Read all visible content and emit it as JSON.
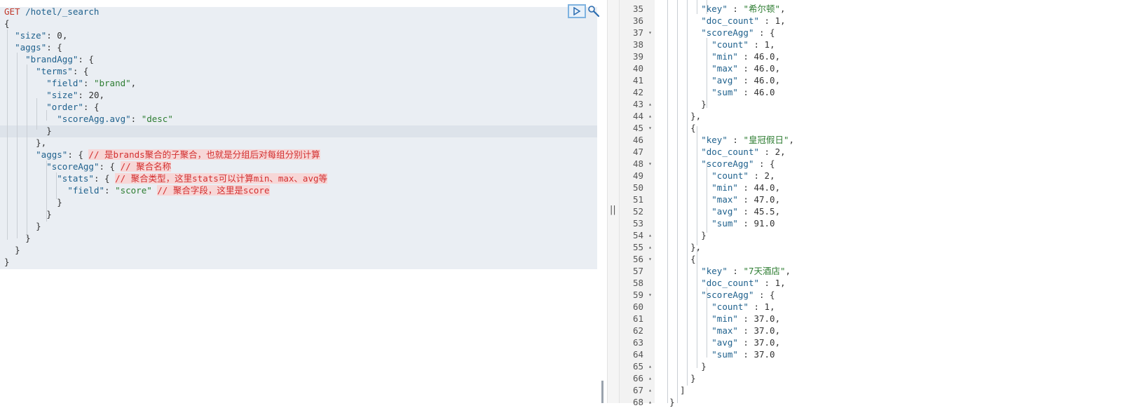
{
  "request": {
    "method": "GET",
    "path": " /hotel/_search",
    "lines": [
      {
        "indent": "",
        "parts": [
          [
            "p",
            "{"
          ]
        ]
      },
      {
        "indent": "  ",
        "parts": [
          [
            "k",
            "\"size\""
          ],
          [
            "p",
            ": "
          ],
          [
            "n",
            "0"
          ],
          [
            "p",
            ","
          ]
        ]
      },
      {
        "indent": "  ",
        "parts": [
          [
            "k",
            "\"aggs\""
          ],
          [
            "p",
            ": {"
          ]
        ]
      },
      {
        "indent": "    ",
        "parts": [
          [
            "k",
            "\"brandAgg\""
          ],
          [
            "p",
            ": {"
          ]
        ]
      },
      {
        "indent": "      ",
        "parts": [
          [
            "k",
            "\"terms\""
          ],
          [
            "p",
            ": {"
          ]
        ]
      },
      {
        "indent": "        ",
        "parts": [
          [
            "k",
            "\"field\""
          ],
          [
            "p",
            ": "
          ],
          [
            "s",
            "\"brand\""
          ],
          [
            "p",
            ","
          ]
        ]
      },
      {
        "indent": "        ",
        "parts": [
          [
            "k",
            "\"size\""
          ],
          [
            "p",
            ": "
          ],
          [
            "n",
            "20"
          ],
          [
            "p",
            ","
          ]
        ]
      },
      {
        "indent": "        ",
        "parts": [
          [
            "k",
            "\"order\""
          ],
          [
            "p",
            ": {"
          ]
        ]
      },
      {
        "indent": "          ",
        "parts": [
          [
            "k",
            "\"scoreAgg.avg\""
          ],
          [
            "p",
            ": "
          ],
          [
            "s",
            "\"desc\""
          ]
        ]
      },
      {
        "indent": "        ",
        "parts": [
          [
            "p",
            "}"
          ]
        ]
      },
      {
        "indent": "      ",
        "parts": [
          [
            "p",
            "},"
          ]
        ]
      },
      {
        "indent": "      ",
        "parts": [
          [
            "k",
            "\"aggs\""
          ],
          [
            "p",
            ": { "
          ],
          [
            "c",
            "// 是brands聚合的子聚合，也就是分组后对每组分别计算"
          ]
        ]
      },
      {
        "indent": "        ",
        "parts": [
          [
            "k",
            "\"scoreAgg\""
          ],
          [
            "p",
            ": { "
          ],
          [
            "c",
            "// 聚合名称"
          ]
        ]
      },
      {
        "indent": "          ",
        "parts": [
          [
            "k",
            "\"stats\""
          ],
          [
            "p",
            ": { "
          ],
          [
            "c",
            "// 聚合类型，这里stats可以计算min、max、avg等"
          ]
        ]
      },
      {
        "indent": "            ",
        "parts": [
          [
            "k",
            "\"field\""
          ],
          [
            "p",
            ": "
          ],
          [
            "s",
            "\"score\""
          ],
          [
            "p",
            " "
          ],
          [
            "c",
            "// 聚合字段，这里是score"
          ]
        ]
      },
      {
        "indent": "          ",
        "parts": [
          [
            "p",
            "}"
          ]
        ]
      },
      {
        "indent": "        ",
        "parts": [
          [
            "p",
            "}"
          ]
        ]
      },
      {
        "indent": "      ",
        "parts": [
          [
            "p",
            "}"
          ]
        ]
      },
      {
        "indent": "    ",
        "parts": [
          [
            "p",
            "}"
          ]
        ]
      },
      {
        "indent": "  ",
        "parts": [
          [
            "p",
            "}"
          ]
        ]
      },
      {
        "indent": "",
        "parts": [
          [
            "p",
            "}"
          ]
        ]
      }
    ]
  },
  "actions": {
    "run_icon": "play-icon",
    "settings_icon": "wrench-icon"
  },
  "divider": {
    "grip": "||"
  },
  "response": {
    "lines": [
      {
        "num": "35",
        "fold": "",
        "indent": "        ",
        "parts": [
          [
            "k",
            "\"key\""
          ],
          [
            "p",
            " : "
          ],
          [
            "s",
            "\"希尔顿\""
          ],
          [
            "p",
            ","
          ]
        ]
      },
      {
        "num": "36",
        "fold": "",
        "indent": "        ",
        "parts": [
          [
            "k",
            "\"doc_count\""
          ],
          [
            "p",
            " : "
          ],
          [
            "n",
            "1"
          ],
          [
            "p",
            ","
          ]
        ]
      },
      {
        "num": "37",
        "fold": "▾",
        "indent": "        ",
        "parts": [
          [
            "k",
            "\"scoreAgg\""
          ],
          [
            "p",
            " : {"
          ]
        ]
      },
      {
        "num": "38",
        "fold": "",
        "indent": "          ",
        "parts": [
          [
            "k",
            "\"count\""
          ],
          [
            "p",
            " : "
          ],
          [
            "n",
            "1"
          ],
          [
            "p",
            ","
          ]
        ]
      },
      {
        "num": "39",
        "fold": "",
        "indent": "          ",
        "parts": [
          [
            "k",
            "\"min\""
          ],
          [
            "p",
            " : "
          ],
          [
            "n",
            "46.0"
          ],
          [
            "p",
            ","
          ]
        ]
      },
      {
        "num": "40",
        "fold": "",
        "indent": "          ",
        "parts": [
          [
            "k",
            "\"max\""
          ],
          [
            "p",
            " : "
          ],
          [
            "n",
            "46.0"
          ],
          [
            "p",
            ","
          ]
        ]
      },
      {
        "num": "41",
        "fold": "",
        "indent": "          ",
        "parts": [
          [
            "k",
            "\"avg\""
          ],
          [
            "p",
            " : "
          ],
          [
            "n",
            "46.0"
          ],
          [
            "p",
            ","
          ]
        ]
      },
      {
        "num": "42",
        "fold": "",
        "indent": "          ",
        "parts": [
          [
            "k",
            "\"sum\""
          ],
          [
            "p",
            " : "
          ],
          [
            "n",
            "46.0"
          ]
        ]
      },
      {
        "num": "43",
        "fold": "▴",
        "indent": "        ",
        "parts": [
          [
            "p",
            "}"
          ]
        ]
      },
      {
        "num": "44",
        "fold": "▴",
        "indent": "      ",
        "parts": [
          [
            "p",
            "},"
          ]
        ]
      },
      {
        "num": "45",
        "fold": "▾",
        "indent": "      ",
        "parts": [
          [
            "p",
            "{"
          ]
        ]
      },
      {
        "num": "46",
        "fold": "",
        "indent": "        ",
        "parts": [
          [
            "k",
            "\"key\""
          ],
          [
            "p",
            " : "
          ],
          [
            "s",
            "\"皇冠假日\""
          ],
          [
            "p",
            ","
          ]
        ]
      },
      {
        "num": "47",
        "fold": "",
        "indent": "        ",
        "parts": [
          [
            "k",
            "\"doc_count\""
          ],
          [
            "p",
            " : "
          ],
          [
            "n",
            "2"
          ],
          [
            "p",
            ","
          ]
        ]
      },
      {
        "num": "48",
        "fold": "▾",
        "indent": "        ",
        "parts": [
          [
            "k",
            "\"scoreAgg\""
          ],
          [
            "p",
            " : {"
          ]
        ]
      },
      {
        "num": "49",
        "fold": "",
        "indent": "          ",
        "parts": [
          [
            "k",
            "\"count\""
          ],
          [
            "p",
            " : "
          ],
          [
            "n",
            "2"
          ],
          [
            "p",
            ","
          ]
        ]
      },
      {
        "num": "50",
        "fold": "",
        "indent": "          ",
        "parts": [
          [
            "k",
            "\"min\""
          ],
          [
            "p",
            " : "
          ],
          [
            "n",
            "44.0"
          ],
          [
            "p",
            ","
          ]
        ]
      },
      {
        "num": "51",
        "fold": "",
        "indent": "          ",
        "parts": [
          [
            "k",
            "\"max\""
          ],
          [
            "p",
            " : "
          ],
          [
            "n",
            "47.0"
          ],
          [
            "p",
            ","
          ]
        ]
      },
      {
        "num": "52",
        "fold": "",
        "indent": "          ",
        "parts": [
          [
            "k",
            "\"avg\""
          ],
          [
            "p",
            " : "
          ],
          [
            "n",
            "45.5"
          ],
          [
            "p",
            ","
          ]
        ]
      },
      {
        "num": "53",
        "fold": "",
        "indent": "          ",
        "parts": [
          [
            "k",
            "\"sum\""
          ],
          [
            "p",
            " : "
          ],
          [
            "n",
            "91.0"
          ]
        ]
      },
      {
        "num": "54",
        "fold": "▴",
        "indent": "        ",
        "parts": [
          [
            "p",
            "}"
          ]
        ]
      },
      {
        "num": "55",
        "fold": "▴",
        "indent": "      ",
        "parts": [
          [
            "p",
            "},"
          ]
        ]
      },
      {
        "num": "56",
        "fold": "▾",
        "indent": "      ",
        "parts": [
          [
            "p",
            "{"
          ]
        ]
      },
      {
        "num": "57",
        "fold": "",
        "indent": "        ",
        "parts": [
          [
            "k",
            "\"key\""
          ],
          [
            "p",
            " : "
          ],
          [
            "s",
            "\"7天酒店\""
          ],
          [
            "p",
            ","
          ]
        ]
      },
      {
        "num": "58",
        "fold": "",
        "indent": "        ",
        "parts": [
          [
            "k",
            "\"doc_count\""
          ],
          [
            "p",
            " : "
          ],
          [
            "n",
            "1"
          ],
          [
            "p",
            ","
          ]
        ]
      },
      {
        "num": "59",
        "fold": "▾",
        "indent": "        ",
        "parts": [
          [
            "k",
            "\"scoreAgg\""
          ],
          [
            "p",
            " : {"
          ]
        ]
      },
      {
        "num": "60",
        "fold": "",
        "indent": "          ",
        "parts": [
          [
            "k",
            "\"count\""
          ],
          [
            "p",
            " : "
          ],
          [
            "n",
            "1"
          ],
          [
            "p",
            ","
          ]
        ]
      },
      {
        "num": "61",
        "fold": "",
        "indent": "          ",
        "parts": [
          [
            "k",
            "\"min\""
          ],
          [
            "p",
            " : "
          ],
          [
            "n",
            "37.0"
          ],
          [
            "p",
            ","
          ]
        ]
      },
      {
        "num": "62",
        "fold": "",
        "indent": "          ",
        "parts": [
          [
            "k",
            "\"max\""
          ],
          [
            "p",
            " : "
          ],
          [
            "n",
            "37.0"
          ],
          [
            "p",
            ","
          ]
        ]
      },
      {
        "num": "63",
        "fold": "",
        "indent": "          ",
        "parts": [
          [
            "k",
            "\"avg\""
          ],
          [
            "p",
            " : "
          ],
          [
            "n",
            "37.0"
          ],
          [
            "p",
            ","
          ]
        ]
      },
      {
        "num": "64",
        "fold": "",
        "indent": "          ",
        "parts": [
          [
            "k",
            "\"sum\""
          ],
          [
            "p",
            " : "
          ],
          [
            "n",
            "37.0"
          ]
        ]
      },
      {
        "num": "65",
        "fold": "▴",
        "indent": "        ",
        "parts": [
          [
            "p",
            "}"
          ]
        ]
      },
      {
        "num": "66",
        "fold": "▴",
        "indent": "      ",
        "parts": [
          [
            "p",
            "}"
          ]
        ]
      },
      {
        "num": "67",
        "fold": "▴",
        "indent": "    ",
        "parts": [
          [
            "p",
            "]"
          ]
        ]
      },
      {
        "num": "68",
        "fold": "▴",
        "indent": "  ",
        "parts": [
          [
            "p",
            "}"
          ]
        ]
      }
    ]
  }
}
